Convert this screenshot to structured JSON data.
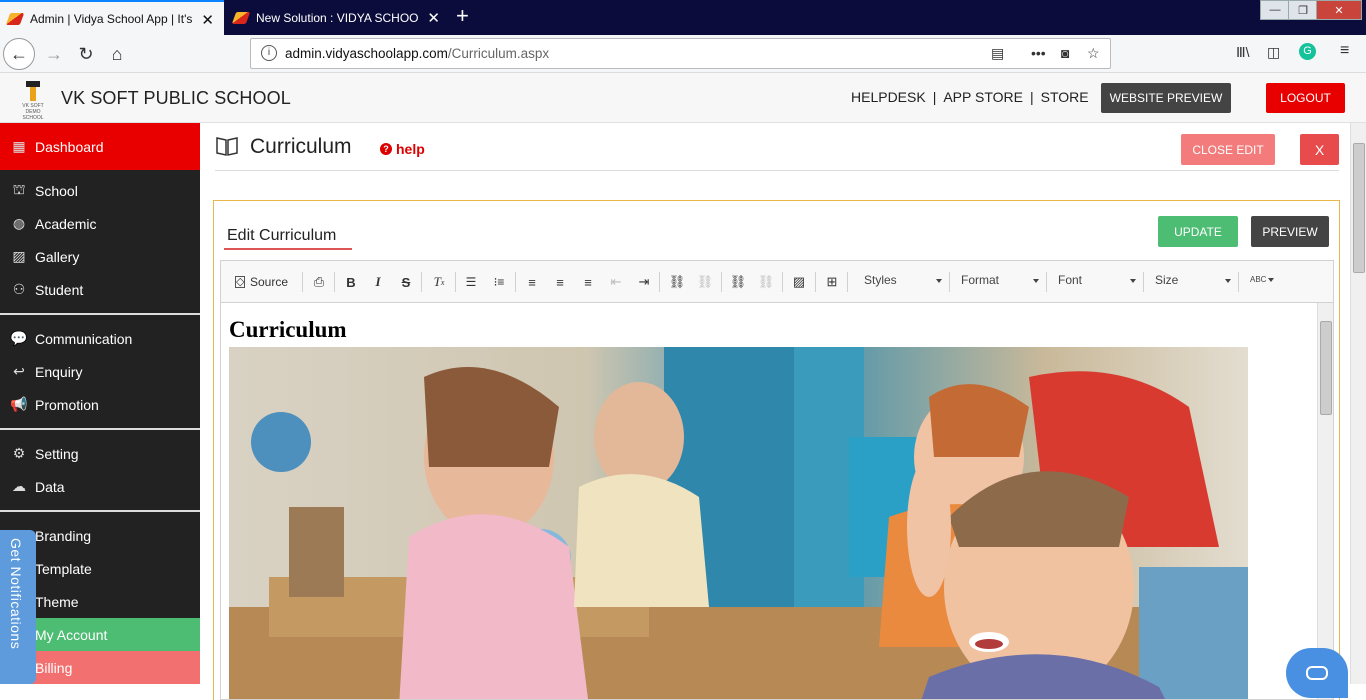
{
  "browser": {
    "tabs": [
      {
        "label": "Admin | Vidya School App | It's",
        "active": true
      },
      {
        "label": "New Solution : VIDYA SCHOOL",
        "active": false
      }
    ],
    "url_domain": "admin.vidyaschoolapp.com",
    "url_path": "/Curriculum.aspx"
  },
  "header": {
    "logo_text": "VK SOFT DEMO SCHOOL",
    "school_name": "VK SOFT PUBLIC SCHOOL",
    "links": [
      "HELPDESK",
      "APP STORE",
      "STORE"
    ],
    "website_preview": "WEBSITE PREVIEW",
    "logout": "LOGOUT"
  },
  "sidebar": {
    "items": [
      {
        "label": "Dashboard",
        "icon": "dashboard-icon"
      },
      {
        "label": "School",
        "icon": "school-icon"
      },
      {
        "label": "Academic",
        "icon": "globe-icon"
      },
      {
        "label": "Gallery",
        "icon": "image-icon"
      },
      {
        "label": "Student",
        "icon": "student-icon"
      },
      {
        "label": "Communication",
        "icon": "chat-icon"
      },
      {
        "label": "Enquiry",
        "icon": "reply-icon"
      },
      {
        "label": "Promotion",
        "icon": "megaphone-icon"
      },
      {
        "label": "Setting",
        "icon": "gear-icon"
      },
      {
        "label": "Data",
        "icon": "cloud-icon"
      },
      {
        "label": "Branding",
        "icon": "brand-icon"
      },
      {
        "label": "Template",
        "icon": "template-icon"
      },
      {
        "label": "Theme",
        "icon": "theme-icon"
      },
      {
        "label": "My Account",
        "icon": "account-icon"
      },
      {
        "label": "Billing",
        "icon": "billing-icon"
      }
    ],
    "notifications_tab": "Get Notifications"
  },
  "main": {
    "title": "Curriculum",
    "help": "help",
    "close_edit": "CLOSE EDIT",
    "close_x": "X",
    "edit_heading": "Edit Curriculum",
    "update": "UPDATE",
    "preview": "PREVIEW",
    "toolbar": {
      "source": "Source",
      "styles": "Styles",
      "format": "Format",
      "font": "Font",
      "size": "Size",
      "spell": "ABC"
    },
    "content_heading": "Curriculum"
  },
  "colors": {
    "sidebar_bg": "#222222",
    "dashboard_red": "#e80000",
    "my_account_green": "#4cbd73",
    "billing_pink": "#f37070",
    "close_edit": "#f37b7b",
    "panel_border": "#e8b84a"
  }
}
